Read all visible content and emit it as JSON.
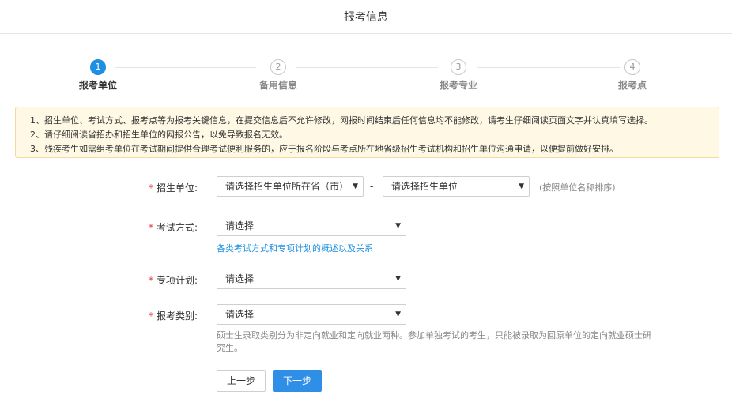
{
  "header": {
    "title": "报考信息"
  },
  "steps": [
    {
      "number": "1",
      "label": "报考单位"
    },
    {
      "number": "2",
      "label": "备用信息"
    },
    {
      "number": "3",
      "label": "报考专业"
    },
    {
      "number": "4",
      "label": "报考点"
    }
  ],
  "active_step": 1,
  "notice": [
    "1、招生单位、考试方式、报考点等为报考关键信息，在提交信息后不允许修改，网报时间结束后任何信息均不能修改，请考生仔细阅读页面文字并认真填写选择。",
    "2、请仔细阅读省招办和招生单位的网报公告，以免导致报名无效。",
    "3、残疾考生如需组考单位在考试期间提供合理考试便利服务的，应于报名阶段与考点所在地省级招生考试机构和招生单位沟通申请，以便提前做好安排。"
  ],
  "form": {
    "required_mark": "*",
    "unit": {
      "label": "招生单位:",
      "province_value": "请选择招生单位所在省（市）",
      "separator": "-",
      "school_value": "请选择招生单位",
      "hint": "(按照单位名称排序)"
    },
    "exam_method": {
      "label": "考试方式:",
      "value": "请选择",
      "link": "各类考试方式和专项计划的概述以及关系"
    },
    "special_plan": {
      "label": "专项计划:",
      "value": "请选择"
    },
    "category": {
      "label": "报考类别:",
      "value": "请选择",
      "description": "硕士生录取类别分为非定向就业和定向就业两种。参加单独考试的考生，只能被录取为回原单位的定向就业硕士研究生。"
    }
  },
  "buttons": {
    "prev": "上一步",
    "next": "下一步"
  },
  "colors": {
    "accent": "#1e8fe1",
    "required": "#e53935",
    "notice_bg": "#fff8e5",
    "notice_border": "#f5d9a0"
  },
  "icons": {
    "select_arrow": "caret-down-icon"
  }
}
